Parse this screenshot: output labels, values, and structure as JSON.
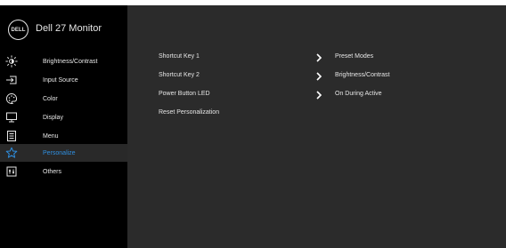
{
  "header": {
    "logo_text": "DELL",
    "monitor_name": "Dell 27 Monitor"
  },
  "sidebar": {
    "items": [
      {
        "label": "Brightness/Contrast",
        "icon": "brightness-icon"
      },
      {
        "label": "Input Source",
        "icon": "input-source-icon"
      },
      {
        "label": "Color",
        "icon": "color-palette-icon"
      },
      {
        "label": "Display",
        "icon": "display-icon"
      },
      {
        "label": "Menu",
        "icon": "menu-icon"
      },
      {
        "label": "Personalize",
        "icon": "star-icon",
        "active": true
      },
      {
        "label": "Others",
        "icon": "others-icon"
      }
    ]
  },
  "main": {
    "options": [
      {
        "label": "Shortcut Key 1",
        "value": "Preset Modes"
      },
      {
        "label": "Shortcut Key 2",
        "value": "Brightness/Contrast"
      },
      {
        "label": "Power Button LED",
        "value": "On During Active"
      },
      {
        "label": "Reset Personalization",
        "value": ""
      }
    ]
  },
  "colors": {
    "accent": "#2f8fe0",
    "panel": "#2b2b2b",
    "sidebar": "#000000"
  }
}
